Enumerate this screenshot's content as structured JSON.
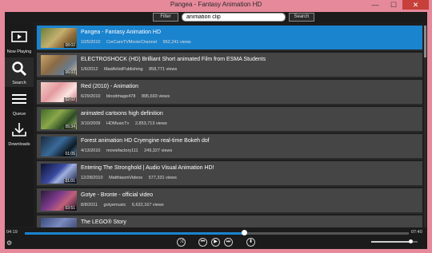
{
  "window": {
    "title": "Pangea - Fantasy Animation HD",
    "min": "—",
    "max": "☐",
    "close": "✕"
  },
  "search": {
    "filter_label": "Filter",
    "query": "animation clip",
    "button_label": "Search"
  },
  "sidebar": {
    "items": [
      {
        "label": "Now Playing"
      },
      {
        "label": "Search"
      },
      {
        "label": "Queue"
      },
      {
        "label": "Downloads"
      }
    ]
  },
  "videos": [
    {
      "title": "Pangea - Fantasy Animation HD",
      "date": "10/5/2010",
      "channel": "CorCareTVMovieChannel",
      "views": "952,241 views",
      "duration": "08:02"
    },
    {
      "title": "ELECTROSHOCK (HD) Brilliant Short animated Film from ESMA Students",
      "date": "1/6/2012",
      "channel": "MadArtistPublishing",
      "views": "858,771 views",
      "duration": "06:03"
    },
    {
      "title": "Red (2010) - Animation",
      "date": "6/29/2010",
      "channel": "bloodmage478",
      "views": "895,693 views",
      "duration": "02:02"
    },
    {
      "title": "animated cartoons high definition",
      "date": "3/10/2009",
      "channel": "HDMusicTv",
      "views": "2,853,713 views",
      "duration": "05:34"
    },
    {
      "title": "Forest animation HD Cryengine real-time Bokeh dof",
      "date": "4/13/2010",
      "channel": "moviefactory111",
      "views": "249,327 views",
      "duration": "01:05"
    },
    {
      "title": "Entering The Stronghold | Audio Visual Animation HD!",
      "date": "12/28/2010",
      "channel": "MatthiasmVideos",
      "views": "577,331 views",
      "duration": "01:01"
    },
    {
      "title": "Gotye - Bronte - official video",
      "date": "8/8/2011",
      "channel": "gotyemusic",
      "views": "6,632,167 views",
      "duration": "03:51"
    },
    {
      "title": "The LEGO® Story",
      "date": "",
      "channel": "",
      "views": "",
      "duration": ""
    }
  ],
  "player": {
    "elapsed": "04:19",
    "total": "07:40",
    "progress": 0.57,
    "volume": 0.84,
    "buttons": [
      "shuffle-icon",
      "prev-icon",
      "play-icon",
      "next-icon",
      "download-icon"
    ]
  },
  "colors": {
    "accent": "#1b84cf",
    "frame": "#e6899b",
    "row": "#454545"
  }
}
